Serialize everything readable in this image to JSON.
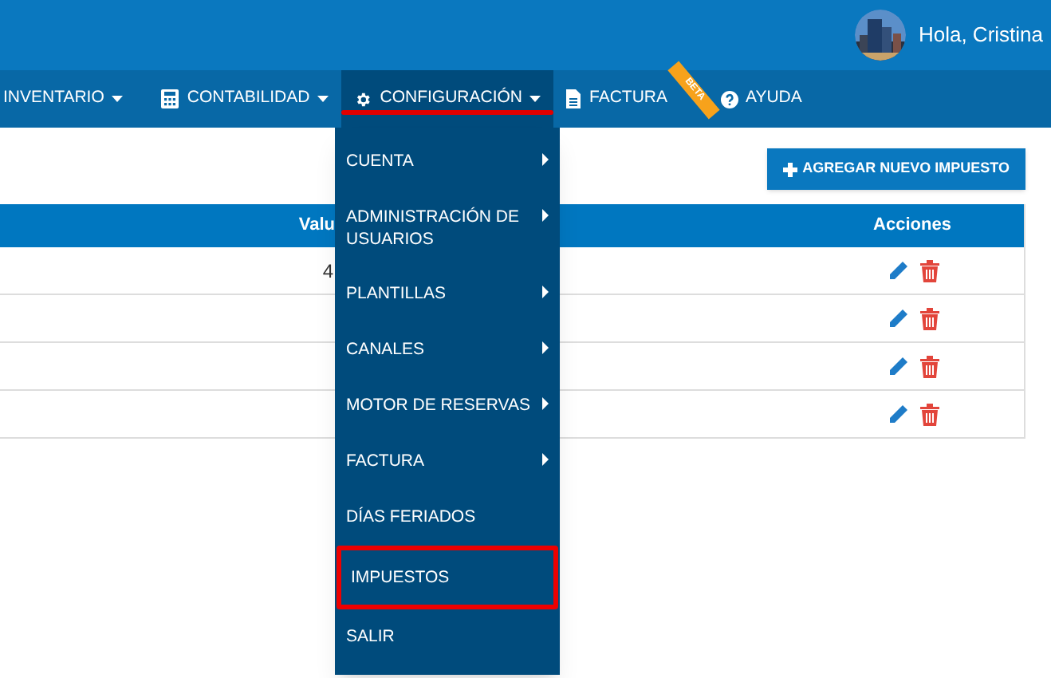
{
  "user": {
    "greeting": "Hola, Cristina"
  },
  "nav": [
    {
      "label": "INVENTARIO",
      "caret": true,
      "selected": false,
      "highlighted": false
    },
    {
      "label": "CONTABILIDAD",
      "caret": true,
      "selected": false,
      "highlighted": false
    },
    {
      "label": "CONFIGURACIÓN",
      "caret": true,
      "selected": true,
      "highlighted": true
    },
    {
      "label": "FACTURA",
      "caret": false,
      "selected": false,
      "highlighted": false,
      "ribbon": "BETA"
    },
    {
      "label": "AYUDA",
      "caret": false,
      "selected": false,
      "highlighted": false
    }
  ],
  "menu": [
    {
      "label": "CUENTA",
      "submenu": true,
      "highlighted": false
    },
    {
      "label": "ADMINISTRACIÓN DE USUARIOS",
      "submenu": true,
      "highlighted": false
    },
    {
      "label": "PLANTILLAS",
      "submenu": true,
      "highlighted": false
    },
    {
      "label": "CANALES",
      "submenu": true,
      "highlighted": false
    },
    {
      "label": "MOTOR DE RESERVAS",
      "submenu": true,
      "highlighted": false
    },
    {
      "label": "FACTURA",
      "submenu": true,
      "highlighted": false
    },
    {
      "label": "DÍAS FERIADOS",
      "submenu": false,
      "highlighted": false
    },
    {
      "label": "IMPUESTOS",
      "submenu": false,
      "highlighted": true
    },
    {
      "label": "SALIR",
      "submenu": false,
      "highlighted": false
    }
  ],
  "add_button": "AGREGAR NUEVO IMPUESTO",
  "table": {
    "columns": [
      "Valu",
      "Acciones"
    ],
    "rows": [
      {
        "value": "4"
      },
      {},
      {},
      {}
    ]
  }
}
